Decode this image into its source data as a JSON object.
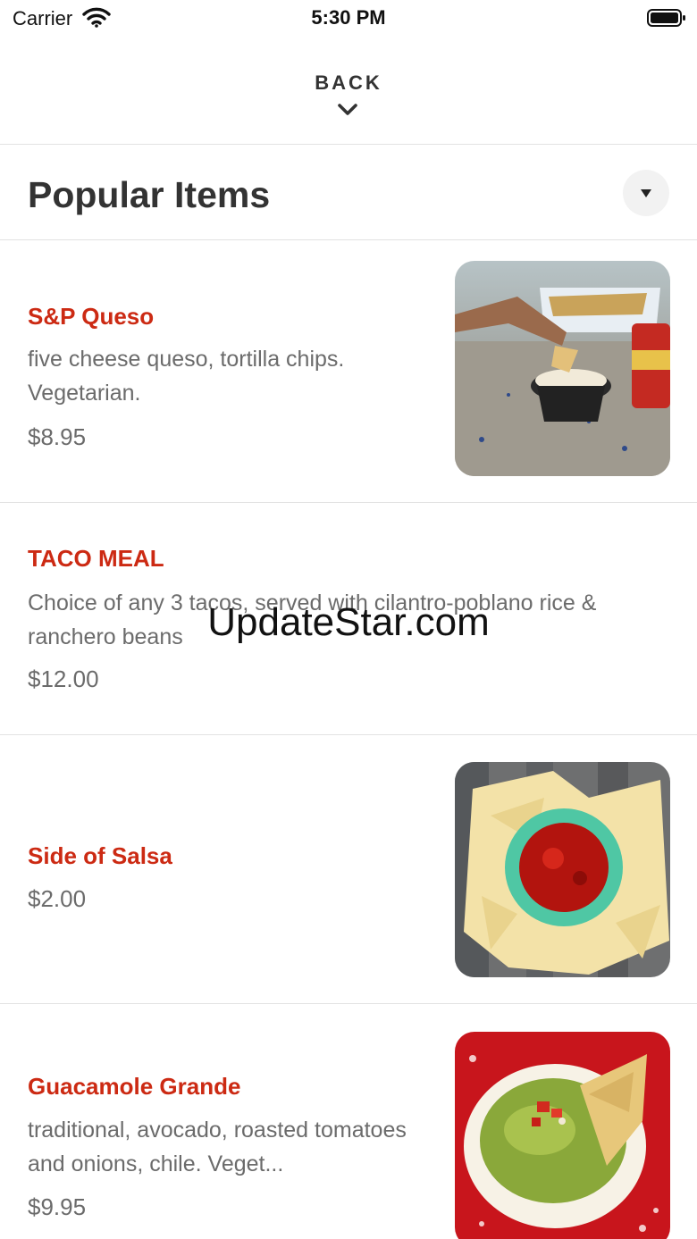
{
  "status_bar": {
    "carrier": "Carrier",
    "time": "5:30 PM"
  },
  "nav": {
    "back_label": "BACK"
  },
  "section": {
    "title": "Popular Items"
  },
  "items": [
    {
      "name": "S&P Queso",
      "description": "five cheese queso, tortilla chips. Vegetarian.",
      "price": "$8.95",
      "photo": "queso-with-chips-photo"
    },
    {
      "name": "TACO MEAL",
      "description": "Choice of any 3 tacos, served with cilantro-poblano rice & ranchero beans",
      "price": "$12.00"
    },
    {
      "name": "Side of Salsa",
      "price": "$2.00",
      "photo": "salsa-bowl-with-chips-photo"
    },
    {
      "name": "Guacamole Grande",
      "description": "traditional, avocado, roasted tomatoes and onions, chile. Veget...",
      "price": "$9.95",
      "photo": "guacamole-bowl-photo"
    }
  ],
  "watermark": "UpdateStar.com",
  "colors": {
    "item_name": "#cc2a13",
    "text_secondary": "#6b6b6b",
    "title": "#333333",
    "divider": "#e2e2e2"
  }
}
